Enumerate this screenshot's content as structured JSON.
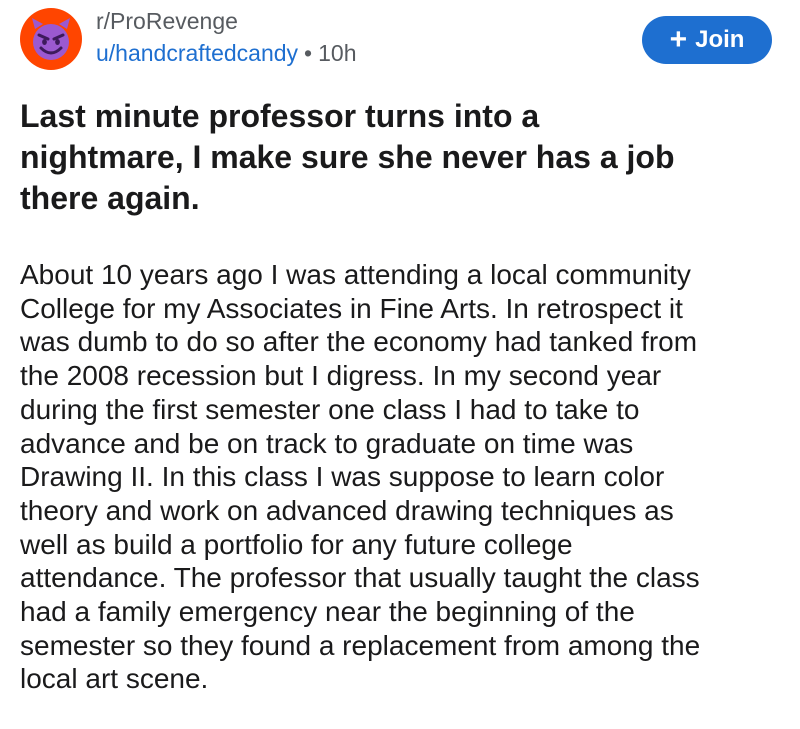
{
  "header": {
    "subreddit": "r/ProRevenge",
    "username": "u/handcraftedcandy",
    "separator": "•",
    "time": "10h",
    "avatar_icon": "devil-face-icon",
    "join_icon": "plus-icon",
    "join_label": "Join"
  },
  "post": {
    "title": "Last minute professor turns into a nightmare, I make sure she never has a job there again.",
    "body_lines": [
      "About 10 years ago I was attending a local community",
      "College for my Associates in Fine Arts. In retrospect it",
      "was dumb to do so after the economy had tanked from",
      "the 2008 recession but I digress. In my second year",
      "during the first semester one class I had to take to",
      "advance and be on track to graduate on time was",
      "Drawing II. In this class I was suppose to learn color",
      "theory and work on advanced drawing techniques as",
      "well as build a portfolio for any future college",
      "attendance. The professor that usually taught the class",
      "had a family emergency near the beginning of the",
      "semester so they found a replacement from among the",
      "local art scene."
    ]
  },
  "colors": {
    "avatar_bg": "#ff4500",
    "devil_face": "#9b59d0",
    "link_blue": "#1e6fd0",
    "meta_gray": "#575b60",
    "text": "#1a1a1b"
  }
}
